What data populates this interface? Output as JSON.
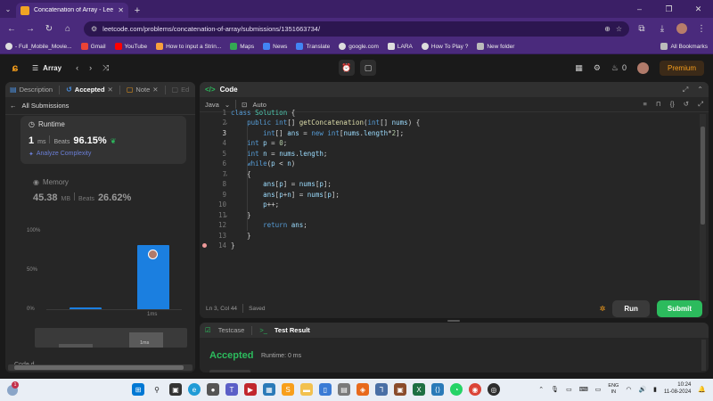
{
  "browser": {
    "tab_title": "Concatenation of Array - LeetC",
    "url": "leetcode.com/problems/concatenation-of-array/submissions/1351663734/",
    "bookmarks": [
      "- Full_Mobile_Movie...",
      "Gmail",
      "YouTube",
      "How to input a Strin...",
      "Maps",
      "News",
      "Translate",
      "google.com",
      "LARA",
      "How To Play ?",
      "New folder"
    ],
    "all_bookmarks": "All Bookmarks"
  },
  "header": {
    "problem_list": "Array",
    "streak": "0",
    "premium": "Premium"
  },
  "left_panel": {
    "tabs": [
      "Description",
      "Accepted",
      "Note",
      "Ed"
    ],
    "back_label": "All Submissions",
    "runtime": {
      "title": "Runtime",
      "value": "1",
      "unit": "ms",
      "beats_label": "Beats",
      "beats_pct": "96.15%",
      "analyze": "Analyze Complexity"
    },
    "memory": {
      "title": "Memory",
      "value": "45.38",
      "unit": "MB",
      "beats_label": "Beats",
      "beats_pct": "26.62%"
    },
    "peek_text": "Code d..."
  },
  "chart_data": {
    "type": "bar",
    "categories": [
      "",
      "1ms"
    ],
    "values": [
      2,
      82
    ],
    "y_ticks": [
      "100%",
      "50%",
      "0%"
    ],
    "ylim": [
      0,
      100
    ],
    "mini_label": "1ms"
  },
  "code_panel": {
    "title": "Code",
    "language": "Java",
    "mode": "Auto",
    "status": "Ln 3, Col 44",
    "saved": "Saved",
    "run": "Run",
    "submit": "Submit",
    "line_numbers": [
      "1",
      "2",
      "3",
      "4",
      "5",
      "6",
      "7",
      "8",
      "9",
      "10",
      "11",
      "12",
      "13",
      "14"
    ],
    "lines": [
      "class Solution {",
      "    public int[] getConcatenation(int[] nums) {",
      "        int[] ans = new int[nums.length*2];",
      "    int p = 0;",
      "    int n = nums.length;",
      "    while(p < n)",
      "    {",
      "        ans[p] = nums[p];",
      "        ans[p+n] = nums[p];",
      "        p++;",
      "    }",
      "        return ans;",
      "    }",
      "}"
    ]
  },
  "test_panel": {
    "tab1": "Testcase",
    "tab2": "Test Result",
    "result": "Accepted",
    "runtime": "Runtime: 0 ms"
  },
  "taskbar": {
    "weather_badge": "1",
    "lang1": "ENG",
    "lang2": "IN",
    "time": "10:24",
    "date": "11-08-2024",
    "badge99": "99+"
  },
  "colors": {
    "accent_green": "#2cbb5d",
    "leetcode_orange": "#f89f1b",
    "chart_blue": "#1b7fe0"
  }
}
